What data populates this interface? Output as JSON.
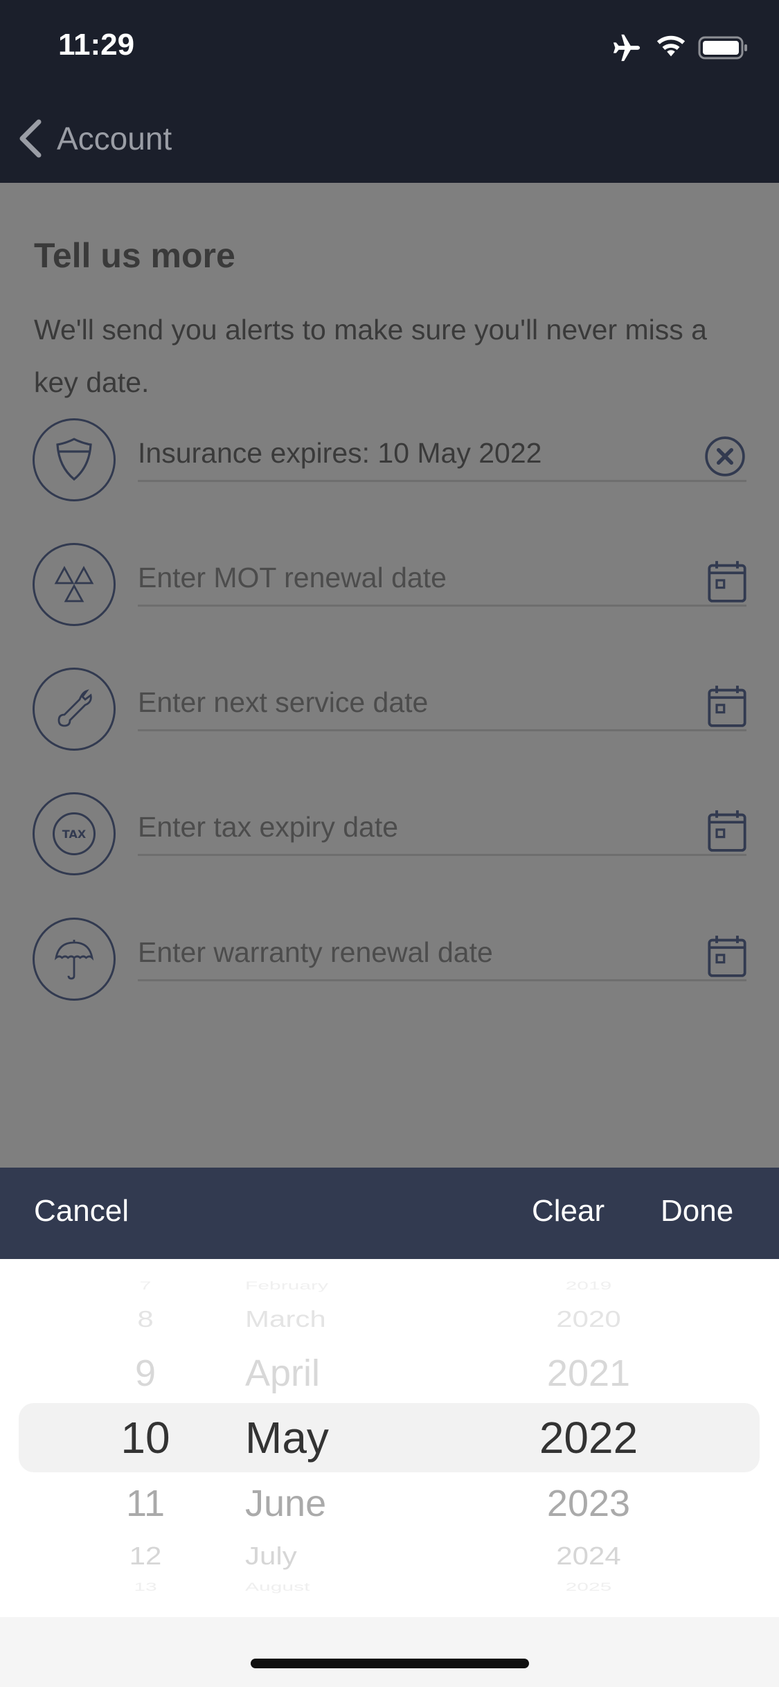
{
  "status_bar": {
    "time": "11:29",
    "icons": [
      "airplane-icon",
      "wifi-icon",
      "battery-icon"
    ]
  },
  "nav": {
    "back_label": "Account"
  },
  "main": {
    "title": "Tell us more",
    "intro": "We'll send you alerts to make sure you'll never miss a key date.",
    "rows": [
      {
        "icon": "shield-icon",
        "value": "Insurance expires: 10 May 2022",
        "placeholder": "",
        "action": "clear-icon"
      },
      {
        "icon": "mot-triangles-icon",
        "value": "",
        "placeholder": "Enter MOT renewal date",
        "action": "calendar-icon"
      },
      {
        "icon": "wrench-icon",
        "value": "",
        "placeholder": "Enter next service date",
        "action": "calendar-icon"
      },
      {
        "icon": "tax-disc-icon",
        "icon_text": "TAX",
        "value": "",
        "placeholder": "Enter tax expiry date",
        "action": "calendar-icon"
      },
      {
        "icon": "umbrella-icon",
        "value": "",
        "placeholder": "Enter warranty renewal date",
        "action": "calendar-icon"
      }
    ]
  },
  "toolbar": {
    "cancel": "Cancel",
    "clear": "Clear",
    "done": "Done"
  },
  "picker": {
    "days": [
      "7",
      "8",
      "9",
      "10",
      "11",
      "12",
      "13"
    ],
    "months": [
      "February",
      "March",
      "April",
      "May",
      "June",
      "July",
      "August"
    ],
    "years": [
      "2019",
      "2020",
      "2021",
      "2022",
      "2023",
      "2024",
      "2025"
    ],
    "selected": {
      "day": "10",
      "month": "May",
      "year": "2022"
    }
  },
  "colors": {
    "nav": "#1b1f2b",
    "toolbar": "#323a50",
    "icon_stroke": "#323a50"
  }
}
